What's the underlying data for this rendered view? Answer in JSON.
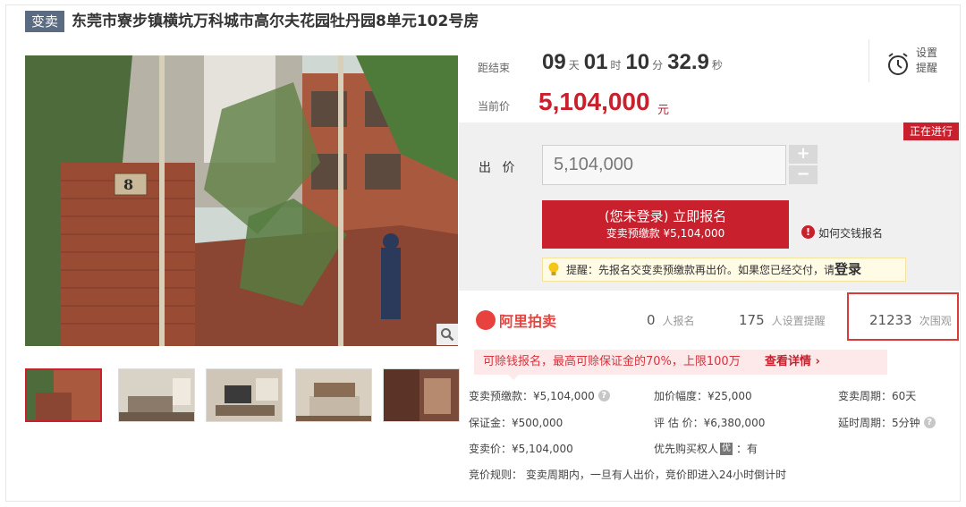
{
  "header": {
    "tag": "变卖",
    "title": "东莞市寮步镇横坑万科城市高尔夫花园牡丹园8单元102号房"
  },
  "gallery": {
    "house_number": "8",
    "thumbnail_count": 5
  },
  "countdown": {
    "label": "距结束",
    "days": "09",
    "days_unit": "天",
    "hours": "01",
    "hours_unit": "时",
    "minutes": "10",
    "minutes_unit": "分",
    "seconds": "32.9",
    "seconds_unit": "秒"
  },
  "current_price": {
    "label": "当前价",
    "value": "5,104,000",
    "unit": "元"
  },
  "reminder": {
    "line1": "设置",
    "line2": "提醒",
    "icon": "alarm-clock-icon"
  },
  "bid": {
    "status": "正在进行",
    "label": "出 价",
    "value": "5,104,000",
    "plus": "+",
    "minus": "−",
    "signup_line1": "(您未登录) 立即报名",
    "signup_line2": "变卖预缴款 ¥5,104,000",
    "how_to": "如何交钱报名",
    "tip_text": "提醒：先报名交变卖预缴款再出价。如果您已经交付，请",
    "tip_login": "登录"
  },
  "stats": {
    "brand": "阿里拍卖",
    "signups_count": "0",
    "signups_label": "人报名",
    "reminders_count": "175",
    "reminders_label": "人设置提醒",
    "views_count": "21233",
    "views_label": "次围观"
  },
  "promo": {
    "text": "可赊钱报名，最高可赊保证金的70%，上限100万",
    "more": "查看详情 ›"
  },
  "details": {
    "prepay": "变卖预缴款：¥5,104,000",
    "increment": "加价幅度：¥25,000",
    "period": "变卖周期：60天",
    "deposit": "保证金：¥500,000",
    "appraisal": "评 估 价：¥6,380,000",
    "delay": "延时周期：5分钟",
    "sale_price": "变卖价：¥5,104,000",
    "priority_label": "优先购买权人",
    "priority_badge": "优",
    "priority_value": "：有",
    "rules": "竞价规则：  变卖周期内，一旦有人出价，竞价即进入24小时倒计时"
  },
  "colors": {
    "accent_red": "#c8202c",
    "tag_bg": "#5a6b82",
    "brand_red": "#e8423f"
  }
}
